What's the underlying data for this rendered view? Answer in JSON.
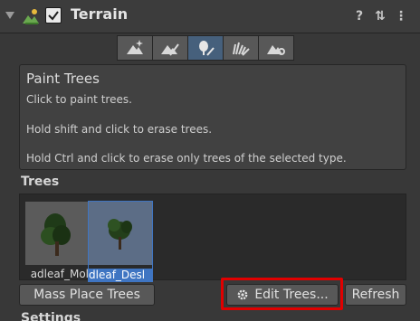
{
  "header": {
    "title": "Terrain",
    "help_label": "?",
    "presets_label": "⇅",
    "menu_label": "⋮"
  },
  "toolbar": {
    "tools": [
      {
        "name": "raise-lower",
        "icon": "terrain-sparkle-icon"
      },
      {
        "name": "paint",
        "icon": "terrain-brush-icon"
      },
      {
        "name": "paint-trees",
        "icon": "tree-brush-icon"
      },
      {
        "name": "paint-details",
        "icon": "grass-brush-icon"
      },
      {
        "name": "settings",
        "icon": "terrain-gear-icon"
      }
    ],
    "active_index": 2
  },
  "info": {
    "title": "Paint Trees",
    "lines": [
      "Click to paint trees.",
      "Hold shift and click to erase trees.",
      "Hold Ctrl and click to erase only trees of the selected type."
    ]
  },
  "trees": {
    "section_label": "Trees",
    "items": [
      {
        "label": "adleaf_Mol",
        "selected": false
      },
      {
        "label": "dleaf_Desl",
        "selected": true
      }
    ]
  },
  "buttons": {
    "mass_place": "Mass Place Trees",
    "edit_trees": "Edit Trees...",
    "refresh": "Refresh"
  },
  "next_section": "Settings",
  "colors": {
    "highlight": "#e00000",
    "selection": "#3f75c2"
  }
}
